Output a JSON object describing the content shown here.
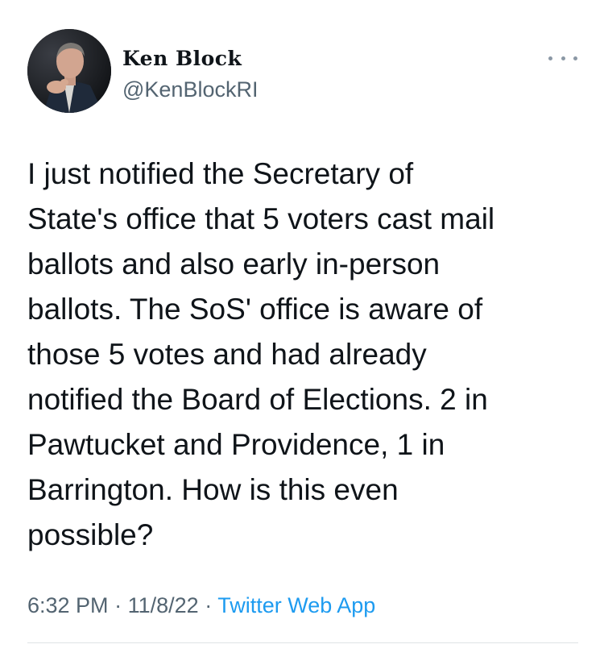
{
  "author": {
    "name": "Ken Block",
    "handle": "@KenBlockRI"
  },
  "tweet": {
    "text": "I just notified the Secretary of\nState's office that 5 voters cast mail\nballots and also early in-person\nballots. The SoS' office is aware of\nthose 5 votes and had already\nnotified the Board of Elections. 2 in\nPawtucket and Providence, 1 in\nBarrington. How is this even\npossible?",
    "time": "6:32 PM",
    "separator": "·",
    "date": "11/8/22",
    "source": "Twitter Web App"
  },
  "icons": {
    "more": "more-horizontal-icon"
  },
  "colors": {
    "text_primary": "#0f1419",
    "text_secondary": "#536471",
    "link": "#1d9bf0",
    "divider": "#dfe3e6"
  }
}
